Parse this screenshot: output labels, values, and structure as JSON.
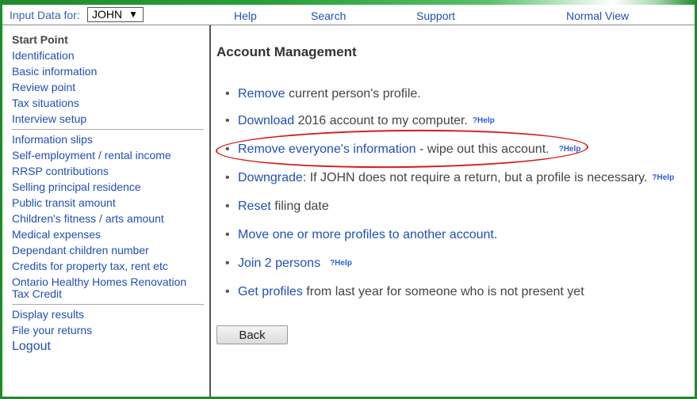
{
  "topbar": {
    "input_label": "Input Data for:",
    "person_selected": "JOHN",
    "links": [
      "Help",
      "Search",
      "Support",
      "Normal View"
    ]
  },
  "sidebar": {
    "group1": [
      "Start Point",
      "Identification",
      "Basic information",
      "Review point",
      "Tax situations",
      "Interview setup"
    ],
    "group2": [
      "Information slips",
      "Self-employment / rental income",
      "RRSP contributions",
      "Selling principal residence",
      "Public transit amount",
      "Children's fitness / arts amount",
      "Medical expenses",
      "Dependant children number",
      "Credits for property tax, rent etc",
      "Ontario Healthy Homes Renovation Tax Credit"
    ],
    "group3": [
      "Display results",
      "File your returns",
      "Logout"
    ]
  },
  "main": {
    "title": "Account Management",
    "options": [
      {
        "link": "Remove",
        "text": " current person's profile.",
        "help": ""
      },
      {
        "link": "Download",
        "text": " 2016 account to my computer.",
        "help": "?Help"
      },
      {
        "link": "Remove everyone's information",
        "text": " - wipe out this account.",
        "help": "?Help"
      },
      {
        "link": "Downgrade",
        "text": ": If JOHN does not require a return, but a profile is necessary.",
        "help": "?Help"
      },
      {
        "link": "Reset",
        "text": " filing date",
        "help": ""
      },
      {
        "link": "Move one or more profiles to another account.",
        "text": "",
        "help": ""
      },
      {
        "link": "Join 2 persons",
        "text": "",
        "help": "?Help"
      },
      {
        "link": "Get profiles",
        "text": " from last year for someone who is not present yet",
        "help": ""
      }
    ],
    "back_label": "Back"
  },
  "colors": {
    "frame_green": "#1f8a2a",
    "link_blue": "#1f4fb5",
    "annotation_red": "#d81a1a"
  }
}
